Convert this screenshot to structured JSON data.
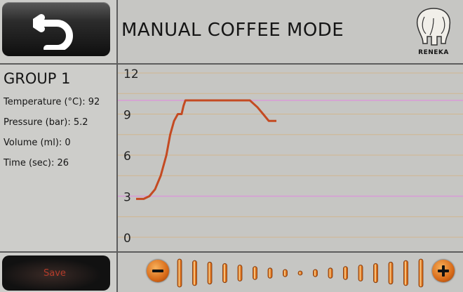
{
  "header": {
    "title": "MANUAL COFFEE MODE",
    "logo_text": "RENEKA"
  },
  "group": {
    "title": "GROUP 1",
    "rows": [
      {
        "label": "Temperature (°C): 92"
      },
      {
        "label": "Pressure (bar): 5.2"
      },
      {
        "label": "Volume (ml): 0"
      },
      {
        "label": "Time (sec): 26"
      }
    ]
  },
  "chart_data": {
    "type": "line",
    "y_ticks": [
      "12",
      "9",
      "6",
      "3",
      "0"
    ],
    "ylim": [
      0,
      12
    ],
    "reference_lines": [
      10,
      3
    ],
    "series": [
      {
        "color": "#c44a22",
        "points": [
          [
            0,
            2.8
          ],
          [
            2,
            2.8
          ],
          [
            3.5,
            3.0
          ],
          [
            5,
            3.5
          ],
          [
            6.5,
            4.5
          ],
          [
            8,
            6.0
          ],
          [
            9,
            7.5
          ],
          [
            10,
            8.5
          ],
          [
            11,
            9.0
          ],
          [
            12,
            9.0
          ],
          [
            12.5,
            9.6
          ],
          [
            13,
            10.0
          ],
          [
            20,
            10.0
          ],
          [
            28,
            10.0
          ],
          [
            30,
            10.0
          ],
          [
            32,
            9.5
          ],
          [
            33.5,
            9.0
          ],
          [
            35,
            8.5
          ],
          [
            37,
            8.5
          ]
        ]
      }
    ]
  },
  "controls": {
    "save_label": "Save",
    "minus_icon": "minus-icon",
    "plus_icon": "plus-icon",
    "bar_count": 17
  },
  "colors": {
    "accent": "#d86a18",
    "curve": "#c44a22",
    "reference": "#d99ad8"
  }
}
